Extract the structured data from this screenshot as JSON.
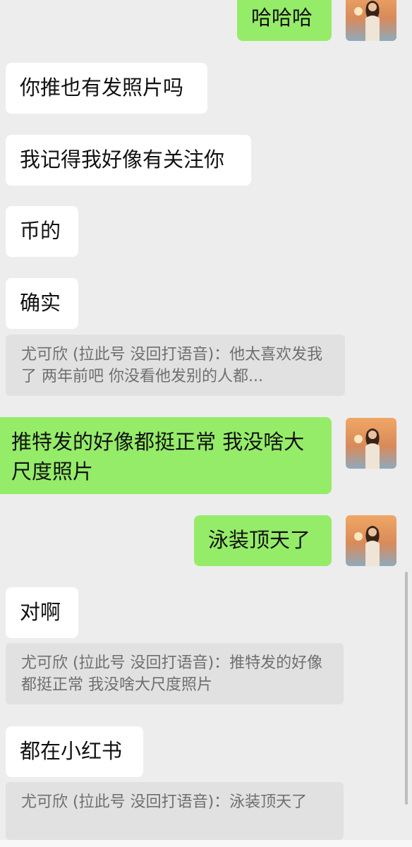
{
  "messages": [
    {
      "side": "right",
      "text": "哈哈哈"
    },
    {
      "side": "left",
      "text": "你推也有发照片吗"
    },
    {
      "side": "left",
      "text": "我记得我好像有关注你"
    },
    {
      "side": "left",
      "text": "币的"
    },
    {
      "side": "left",
      "text": "确实"
    },
    {
      "side": "quote",
      "text": "尤可欣 (拉此号 没回打语音)：他太喜欢发我了 两年前吧 你没看他发别的人都..."
    },
    {
      "side": "right",
      "text": "推特发的好像都挺正常 我没啥大尺度照片"
    },
    {
      "side": "right",
      "text": "泳装顶天了"
    },
    {
      "side": "left",
      "text": "对啊"
    },
    {
      "side": "quote",
      "text": "尤可欣 (拉此号 没回打语音)：推特发的好像都挺正常 我没啥大尺度照片"
    },
    {
      "side": "left",
      "text": "都在小红书"
    },
    {
      "side": "quote",
      "text": "尤可欣 (拉此号 没回打语音)：泳装顶天了"
    }
  ],
  "avatar": {
    "icon": "user-avatar-icon",
    "colors": [
      "#f2b36b",
      "#d98a5a",
      "#a9c0d0"
    ]
  }
}
